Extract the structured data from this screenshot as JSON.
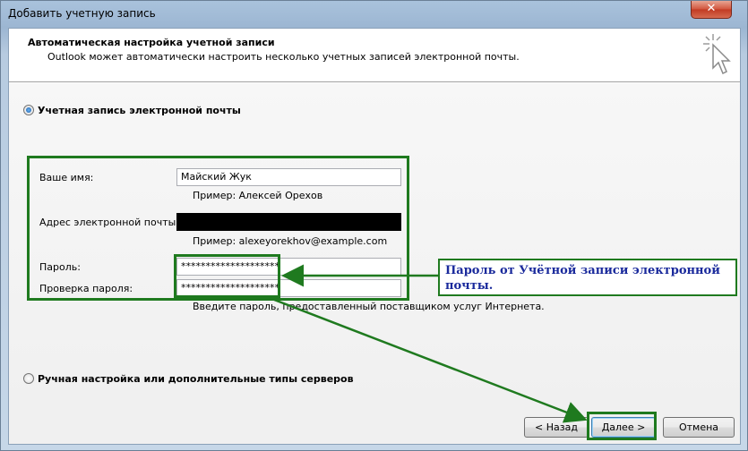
{
  "window": {
    "title": "Добавить учетную запись",
    "close_label": "✕"
  },
  "header": {
    "title": "Автоматическая настройка учетной записи",
    "subtitle": "Outlook может автоматически настроить несколько учетных записей электронной почты."
  },
  "options": {
    "email_account": {
      "label": "Учетная запись электронной почты",
      "checked": true
    },
    "manual": {
      "label": "Ручная настройка или дополнительные типы серверов",
      "checked": false
    }
  },
  "form": {
    "name": {
      "label": "Ваше имя:",
      "value": "Майский Жук",
      "hint": "Пример: Алексей Орехов"
    },
    "email": {
      "label": "Адрес электронной почты:",
      "value": "",
      "hint": "Пример: alexeyorekhov@example.com"
    },
    "password": {
      "label": "Пароль:",
      "value": "********************"
    },
    "password_confirm": {
      "label": "Проверка пароля:",
      "value": "********************"
    },
    "password_hint": "Введите пароль, предоставленный поставщиком услуг Интернета."
  },
  "annotation": {
    "text": "Пароль от Учётной записи электронной почты."
  },
  "buttons": {
    "back": "< Назад",
    "next": "Далее >",
    "cancel": "Отмена"
  },
  "colors": {
    "annotation_green": "#1f7a1f",
    "annotation_text": "#1a2a9c",
    "redacted": "#000000"
  }
}
